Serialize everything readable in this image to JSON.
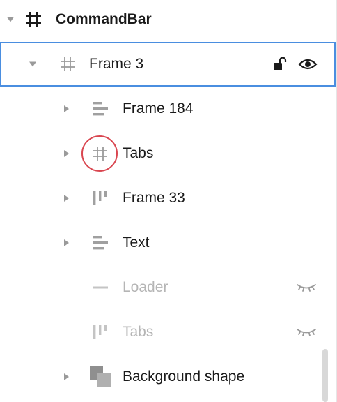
{
  "layers": {
    "root": {
      "label": "CommandBar",
      "icon": "frame-hash-icon"
    },
    "items": [
      {
        "label": "Frame 3",
        "icon": "frame-hash-icon",
        "selected": true
      },
      {
        "label": "Frame 184",
        "icon": "horizontal-stack-icon"
      },
      {
        "label": "Tabs",
        "icon": "frame-hash-icon"
      },
      {
        "label": "Frame 33",
        "icon": "vertical-stack-icon"
      },
      {
        "label": "Text",
        "icon": "horizontal-stack-icon"
      },
      {
        "label": "Loader",
        "icon": "line-icon",
        "hidden": true
      },
      {
        "label": "Tabs",
        "icon": "vertical-stack-icon",
        "hidden": true
      },
      {
        "label": "Background shape",
        "icon": "shape-icon"
      }
    ]
  },
  "colors": {
    "selection_border": "#4a8ee0",
    "highlight_ring": "#d9454f",
    "dim_text": "#b5b5b5"
  }
}
